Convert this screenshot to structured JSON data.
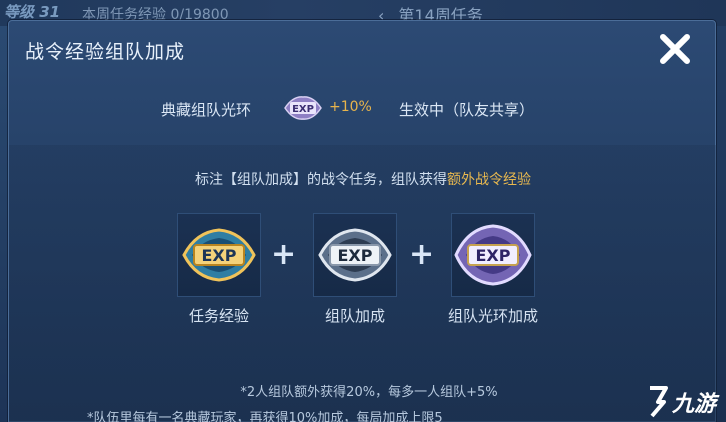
{
  "background": {
    "level_text": "等级 31",
    "week_exp": "本周任务经验 0/19800",
    "week_nav_prev": "‹",
    "week_title": "第14周任务"
  },
  "modal": {
    "title": "战令经验组队加成",
    "close_icon": "close-icon",
    "aura": {
      "name": "典藏组队光环",
      "badge_text": "EXP",
      "bonus": "+10%",
      "status": "生效中（队友共享）"
    },
    "description": {
      "prefix": "标注【组队加成】的战令任务，组队获得",
      "highlight": "额外战令经验"
    },
    "tiles": [
      {
        "label": "任务经验",
        "badge_text": "EXP",
        "style": "gold"
      },
      {
        "label": "组队加成",
        "badge_text": "EXP",
        "style": "silver"
      },
      {
        "label": "组队光环加成",
        "badge_text": "EXP",
        "style": "purple"
      }
    ],
    "plus": "+",
    "notes": [
      "*2人组队额外获得20%，每多一人组队+5%",
      "*队伍里每有一名典藏玩家，再获得10%加成，每局加成上限5"
    ]
  },
  "colors": {
    "accent_gold": "#e9b94f",
    "panel_bg": "#27436a",
    "text": "#dbe7f5"
  },
  "watermark": {
    "text": "九游"
  }
}
